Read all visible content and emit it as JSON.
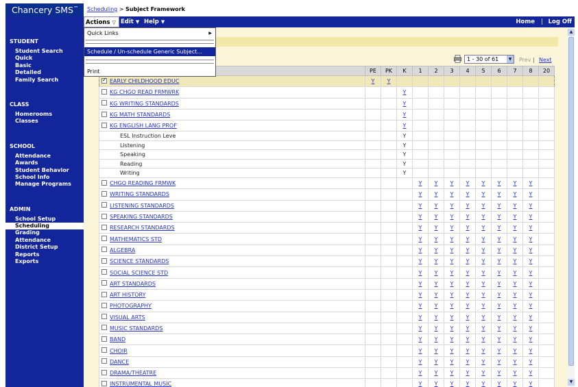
{
  "app": {
    "title": "Chancery SMS",
    "tm": "™"
  },
  "breadcrumb": {
    "parent": "Scheduling",
    "separator": ">",
    "current": "Subject Framework"
  },
  "menubar": {
    "actions": "Actions",
    "edit": "Edit",
    "help": "Help",
    "home": "Home",
    "separator": "|",
    "logoff": "Log Off"
  },
  "actions_menu": {
    "quick_links": "Quick Links",
    "schedule": "Schedule / Un-schedule Generic Subject...",
    "print": "Print"
  },
  "sidebar": {
    "sections": [
      {
        "title": "STUDENT",
        "items": [
          "Student Search",
          "Quick",
          "Basic",
          "Detailed",
          "Family Search"
        ]
      },
      {
        "title": "CLASS",
        "items": [
          "Homerooms",
          "Classes"
        ]
      },
      {
        "title": "SCHOOL",
        "items": [
          "Attendance",
          "Awards",
          "Student Behavior",
          "School Info",
          "Manage Programs"
        ]
      },
      {
        "title": "ADMIN",
        "items": [
          "School Setup",
          "Scheduling",
          "Grading",
          "Attendance",
          "District Setup",
          "Reports",
          "Exports"
        ]
      }
    ],
    "active_item": "Scheduling"
  },
  "pager": {
    "range": "1 - 30 of 61",
    "prev": "Prev",
    "separator": "|",
    "next": "Next"
  },
  "grid": {
    "columns": [
      "PE",
      "PK",
      "K",
      "1",
      "2",
      "3",
      "4",
      "5",
      "6",
      "7",
      "8",
      "20"
    ],
    "rows": [
      {
        "name": "EARLY CHILDHOOD EDUC",
        "type": "subject",
        "checked": true,
        "selected": true,
        "marks": [
          "Y",
          "Y",
          "",
          "",
          "",
          "",
          "",
          "",
          "",
          "",
          "",
          ""
        ]
      },
      {
        "name": "KG CHGO READ FRMWRK",
        "type": "subject",
        "checked": false,
        "marks": [
          "",
          "",
          "Y",
          "",
          "",
          "",
          "",
          "",
          "",
          "",
          "",
          ""
        ]
      },
      {
        "name": "KG WRITING STANDARDS",
        "type": "subject",
        "checked": false,
        "marks": [
          "",
          "",
          "Y",
          "",
          "",
          "",
          "",
          "",
          "",
          "",
          "",
          ""
        ]
      },
      {
        "name": "KG MATH STANDARDS",
        "type": "subject",
        "checked": false,
        "marks": [
          "",
          "",
          "Y",
          "",
          "",
          "",
          "",
          "",
          "",
          "",
          "",
          ""
        ]
      },
      {
        "name": "KG ENGLISH LANG PROF",
        "type": "subject",
        "checked": false,
        "marks": [
          "",
          "",
          "Y",
          "",
          "",
          "",
          "",
          "",
          "",
          "",
          "",
          ""
        ]
      },
      {
        "name": "ESL Instruction Leve",
        "type": "sub",
        "marks": [
          "",
          "",
          "Y",
          "",
          "",
          "",
          "",
          "",
          "",
          "",
          "",
          ""
        ]
      },
      {
        "name": "Listening",
        "type": "sub",
        "marks": [
          "",
          "",
          "Y",
          "",
          "",
          "",
          "",
          "",
          "",
          "",
          "",
          ""
        ]
      },
      {
        "name": "Speaking",
        "type": "sub",
        "marks": [
          "",
          "",
          "Y",
          "",
          "",
          "",
          "",
          "",
          "",
          "",
          "",
          ""
        ]
      },
      {
        "name": "Reading",
        "type": "sub",
        "marks": [
          "",
          "",
          "Y",
          "",
          "",
          "",
          "",
          "",
          "",
          "",
          "",
          ""
        ]
      },
      {
        "name": "Writing",
        "type": "sub",
        "marks": [
          "",
          "",
          "Y",
          "",
          "",
          "",
          "",
          "",
          "",
          "",
          "",
          ""
        ]
      },
      {
        "name": "CHGO READING FRMWK",
        "type": "subject",
        "checked": false,
        "marks": [
          "",
          "",
          "",
          "Y",
          "Y",
          "Y",
          "Y",
          "Y",
          "Y",
          "Y",
          "Y",
          ""
        ]
      },
      {
        "name": "WRITING STANDARDS",
        "type": "subject",
        "checked": false,
        "marks": [
          "",
          "",
          "",
          "Y",
          "Y",
          "Y",
          "Y",
          "Y",
          "Y",
          "Y",
          "Y",
          ""
        ]
      },
      {
        "name": "LISTENING STANDARDS",
        "type": "subject",
        "checked": false,
        "marks": [
          "",
          "",
          "",
          "Y",
          "Y",
          "Y",
          "Y",
          "Y",
          "Y",
          "Y",
          "Y",
          ""
        ]
      },
      {
        "name": "SPEAKING STANDARDS",
        "type": "subject",
        "checked": false,
        "marks": [
          "",
          "",
          "",
          "Y",
          "Y",
          "Y",
          "Y",
          "Y",
          "Y",
          "Y",
          "Y",
          ""
        ]
      },
      {
        "name": "RESEARCH STANDARDS",
        "type": "subject",
        "checked": false,
        "marks": [
          "",
          "",
          "",
          "Y",
          "Y",
          "Y",
          "Y",
          "Y",
          "Y",
          "Y",
          "Y",
          ""
        ]
      },
      {
        "name": "MATHEMATICS STD",
        "type": "subject",
        "checked": false,
        "marks": [
          "",
          "",
          "",
          "Y",
          "Y",
          "Y",
          "Y",
          "Y",
          "Y",
          "Y",
          "Y",
          ""
        ]
      },
      {
        "name": "ALGEBRA",
        "type": "subject",
        "checked": false,
        "marks": [
          "",
          "",
          "",
          "Y",
          "Y",
          "Y",
          "Y",
          "Y",
          "Y",
          "Y",
          "Y",
          ""
        ]
      },
      {
        "name": "SCIENCE STANDARDS",
        "type": "subject",
        "checked": false,
        "marks": [
          "",
          "",
          "",
          "Y",
          "Y",
          "Y",
          "Y",
          "Y",
          "Y",
          "Y",
          "Y",
          ""
        ]
      },
      {
        "name": "SOCIAL SCIENCE STD",
        "type": "subject",
        "checked": false,
        "marks": [
          "",
          "",
          "",
          "Y",
          "Y",
          "Y",
          "Y",
          "Y",
          "Y",
          "Y",
          "Y",
          ""
        ]
      },
      {
        "name": "ART STANDARDS",
        "type": "subject",
        "checked": false,
        "marks": [
          "",
          "",
          "",
          "Y",
          "Y",
          "Y",
          "Y",
          "Y",
          "Y",
          "Y",
          "Y",
          ""
        ]
      },
      {
        "name": "ART HISTORY",
        "type": "subject",
        "checked": false,
        "marks": [
          "",
          "",
          "",
          "Y",
          "Y",
          "Y",
          "Y",
          "Y",
          "Y",
          "Y",
          "Y",
          ""
        ]
      },
      {
        "name": "PHOTOGRAPHY",
        "type": "subject",
        "checked": false,
        "marks": [
          "",
          "",
          "",
          "Y",
          "Y",
          "Y",
          "Y",
          "Y",
          "Y",
          "Y",
          "Y",
          ""
        ]
      },
      {
        "name": "VISUAL ARTS",
        "type": "subject",
        "checked": false,
        "marks": [
          "",
          "",
          "",
          "Y",
          "Y",
          "Y",
          "Y",
          "Y",
          "Y",
          "Y",
          "Y",
          ""
        ]
      },
      {
        "name": "MUSIC STANDARDS",
        "type": "subject",
        "checked": false,
        "marks": [
          "",
          "",
          "",
          "Y",
          "Y",
          "Y",
          "Y",
          "Y",
          "Y",
          "Y",
          "Y",
          ""
        ]
      },
      {
        "name": "BAND",
        "type": "subject",
        "checked": false,
        "marks": [
          "",
          "",
          "",
          "Y",
          "Y",
          "Y",
          "Y",
          "Y",
          "Y",
          "Y",
          "Y",
          ""
        ]
      },
      {
        "name": "CHOIR",
        "type": "subject",
        "checked": false,
        "marks": [
          "",
          "",
          "",
          "Y",
          "Y",
          "Y",
          "Y",
          "Y",
          "Y",
          "Y",
          "Y",
          ""
        ]
      },
      {
        "name": "DANCE",
        "type": "subject",
        "checked": false,
        "marks": [
          "",
          "",
          "",
          "Y",
          "Y",
          "Y",
          "Y",
          "Y",
          "Y",
          "Y",
          "Y",
          ""
        ]
      },
      {
        "name": "DRAMA/THEATRE",
        "type": "subject",
        "checked": false,
        "marks": [
          "",
          "",
          "",
          "Y",
          "Y",
          "Y",
          "Y",
          "Y",
          "Y",
          "Y",
          "Y",
          ""
        ]
      },
      {
        "name": "INSTRUMENTAL MUSIC",
        "type": "subject",
        "checked": false,
        "marks": [
          "",
          "",
          "",
          "Y",
          "Y",
          "Y",
          "Y",
          "Y",
          "Y",
          "Y",
          "Y",
          ""
        ]
      }
    ]
  },
  "colors": {
    "nav_blue": "#13259b",
    "content_bg": "#fbf6d9",
    "link": "#2233cc",
    "selected_row": "#f0e8b8"
  }
}
